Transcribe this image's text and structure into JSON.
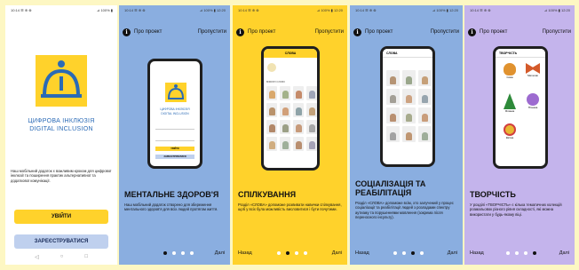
{
  "colors": {
    "yellow": "#ffd22b",
    "blue": "#8aaee0",
    "purple": "#c4b4ec",
    "brand_blue": "#2a6ab6"
  },
  "screen1": {
    "status_left": "10:14 ☰ ⊕ ⊗",
    "status_right": "⊿ 100% ▮",
    "logo_icon": "person-arch-icon",
    "title_line1": "ЦИФРОВА ІНКЛЮЗІЯ",
    "title_line2": "DIGITAL INCLUSION",
    "intro": "Наш мобільний додаток є важливим кроком для цифрової інклюзії та поширення практик альтернативної та додаткової комунікації.",
    "login_label": "УВІЙТИ",
    "register_label": "ЗАРЕЄСТРУВАТИСЯ",
    "nav": [
      "◁",
      "○",
      "□"
    ]
  },
  "screen2": {
    "status_left": "10:14 ☰ ⊕ ⊗",
    "status_right": "⊿ 100% ▮ 12:20",
    "about": "Про проект",
    "skip": "Пропустити",
    "heading": "МЕНТАЛЬНЕ ЗДОРОВ'Я",
    "desc": "Наш мобільний додаток створено для збереження ментального здоров'я для всіх людей протягом життя.",
    "next": "Далі",
    "phone_title_line1": "ЦИФРОВА ІНКЛЮЗІЯ",
    "phone_title_line2": "DIGITAL INCLUSION",
    "phone_login": "УВІЙТИ",
    "phone_register": "ЗАРЕЄСТРУВАТИСЯ"
  },
  "screen3": {
    "status_left": "10:14 ☰ ⊕ ⊗",
    "status_right": "⊿ 100% ▮ 12:20",
    "about": "Про проект",
    "skip": "Пропустити",
    "heading": "СПІЛКУВАННЯ",
    "desc": "Розділ «СЛОВА» допоможе розвивати навички спілкування, щоб у всіх була можливість висловитися і бути почутими.",
    "back": "Назад",
    "next": "Далі",
    "phone_header": "СЛОВА",
    "phone_section": "ВИБРАТИ СЛОВО"
  },
  "screen4": {
    "status_left": "10:14 ☰ ⊕ ⊗",
    "status_right": "⊿ 100% ▮ 12:20",
    "about": "Про проект",
    "skip": "Пропустити",
    "heading_line1": "СОЦІАЛІЗАЦІЯ ТА",
    "heading_line2": "РЕАБІЛІТАЦІЯ",
    "desc": "Розділ «СЛОВА» допоможе всім, хто залучений у процес соціалізації та реабілітації людей з розладами спектру аутизму та порушеннями мовлення (зокрема після переносного інсульту).",
    "back": "Назад",
    "next": "Далі",
    "phone_header": "СЛОВА"
  },
  "screen5": {
    "status_left": "10:14 ☰ ⊕ ⊗",
    "status_right": "⊿ 100% ▮ 12:20",
    "about": "Про проект",
    "skip": "Пропустити",
    "heading": "ТВОРЧІСТЬ",
    "desc": "У розділі «ТВОРЧІСТЬ» є кілька тематичних колекцій розмальовок різного рівня складності, які можна використати у будь-якому віці.",
    "back": "Назад",
    "next": "Далі",
    "phone_header": "ТВОРЧІСТЬ",
    "items": [
      "Сова",
      "Метелик",
      "Ялинка",
      "Пташка",
      "Квітка"
    ]
  }
}
